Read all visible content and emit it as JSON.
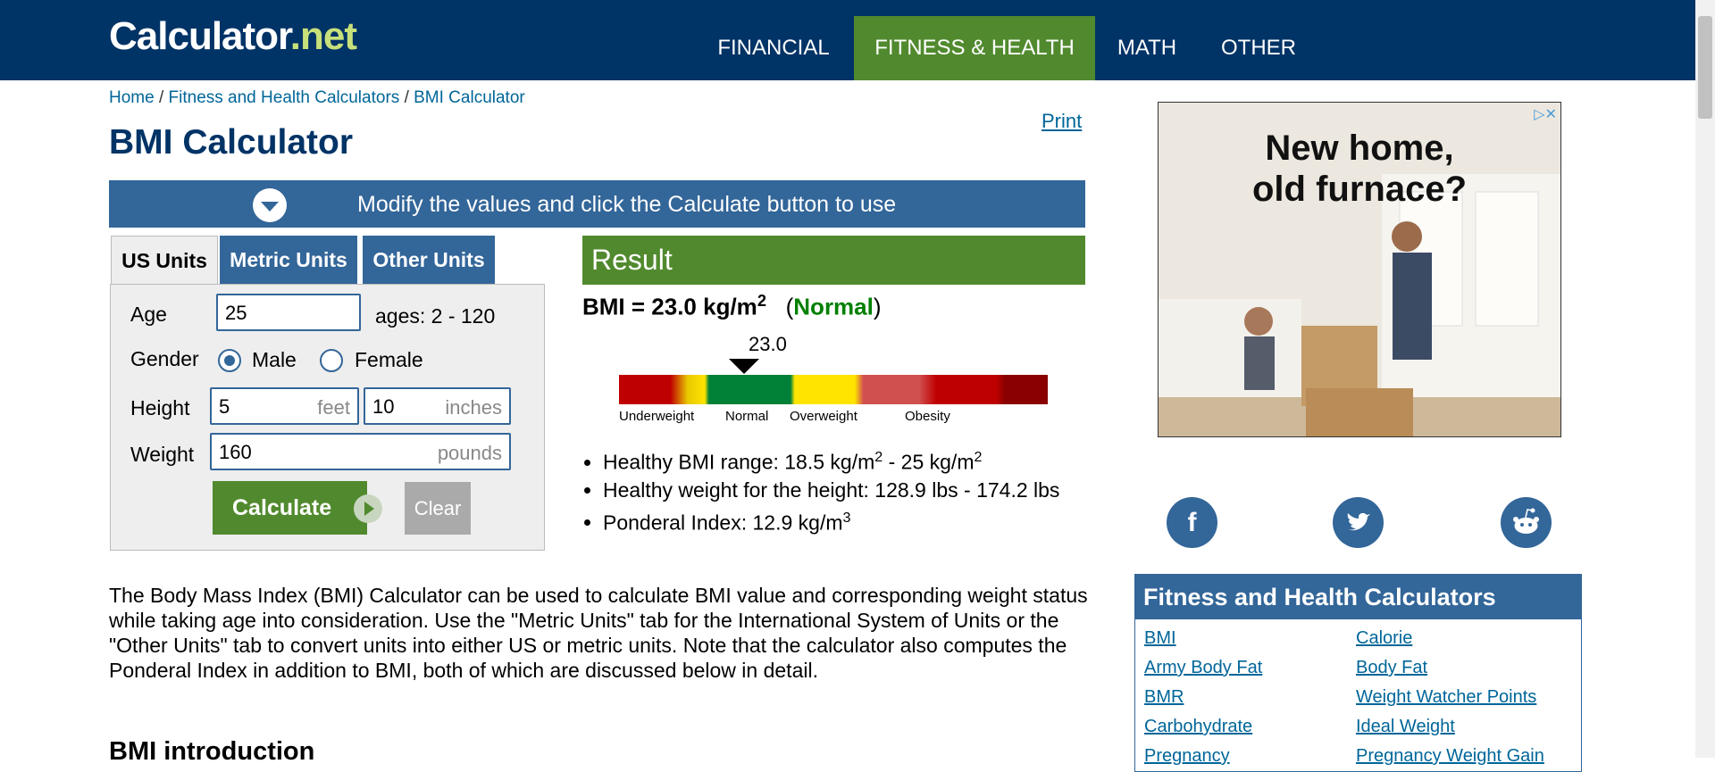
{
  "nav": {
    "logo_main": "Calculator",
    "logo_dot": ".",
    "logo_tld": "net",
    "items": [
      "FINANCIAL",
      "FITNESS & HEALTH",
      "MATH",
      "OTHER"
    ]
  },
  "breadcrumb": {
    "home": "Home",
    "sep": "/",
    "section": "Fitness and Health Calculators",
    "current": "BMI Calculator"
  },
  "print_label": "Print",
  "page_title": "BMI Calculator",
  "banner_text": "Modify the values and click the Calculate button to use",
  "tabs": [
    "US Units",
    "Metric Units",
    "Other Units"
  ],
  "form": {
    "age_label": "Age",
    "age_value": "25",
    "age_hint": "ages: 2 - 120",
    "gender_label": "Gender",
    "male_label": "Male",
    "female_label": "Female",
    "gender_selected": "Male",
    "height_label": "Height",
    "feet_value": "5",
    "feet_unit": "feet",
    "inches_value": "10",
    "inches_unit": "inches",
    "weight_label": "Weight",
    "weight_value": "160",
    "weight_unit": "pounds",
    "calculate_label": "Calculate",
    "clear_label": "Clear"
  },
  "result": {
    "heading": "Result",
    "bmi_prefix": "BMI = 23.0 kg/m",
    "bmi_sup": "2",
    "open_paren": "(",
    "classification": "Normal",
    "close_paren": ")",
    "gauge_value": "23.0",
    "gauge_value_num": 23.0,
    "gauge_labels": [
      "Underweight",
      "Normal",
      "Overweight",
      "Obesity"
    ],
    "bullets": [
      {
        "text": "Healthy BMI range: 18.5 kg/m",
        "sup1": "2",
        "mid": " - 25 kg/m",
        "sup2": "2"
      },
      {
        "text": "Healthy weight for the height: 128.9 lbs - 174.2 lbs"
      },
      {
        "text": "Ponderal Index: 12.9 kg/m",
        "sup1": "3"
      }
    ]
  },
  "description": "The Body Mass Index (BMI) Calculator can be used to calculate BMI value and corresponding weight status while taking age into consideration. Use the \"Metric Units\" tab for the International System of Units or the \"Other Units\" tab to convert units into either US or metric units. Note that the calculator also computes the Ponderal Index in addition to BMI, both of which are discussed below in detail.",
  "intro_heading": "BMI introduction",
  "ad": {
    "headline_1": "New home,",
    "headline_2": "old furnace?"
  },
  "social": [
    "facebook-icon",
    "twitter-icon",
    "reddit-icon"
  ],
  "side_panel": {
    "heading": "Fitness and Health Calculators",
    "links": [
      [
        "BMI",
        "Calorie"
      ],
      [
        "Army Body Fat",
        "Body Fat"
      ],
      [
        "BMR",
        "Weight Watcher Points"
      ],
      [
        "Carbohydrate",
        "Ideal Weight"
      ],
      [
        "Pregnancy",
        "Pregnancy Weight Gain"
      ]
    ]
  },
  "colors": {
    "nav_bg": "#003366",
    "accent_green": "#518a2e",
    "accent_blue": "#336699",
    "link": "#006699"
  }
}
